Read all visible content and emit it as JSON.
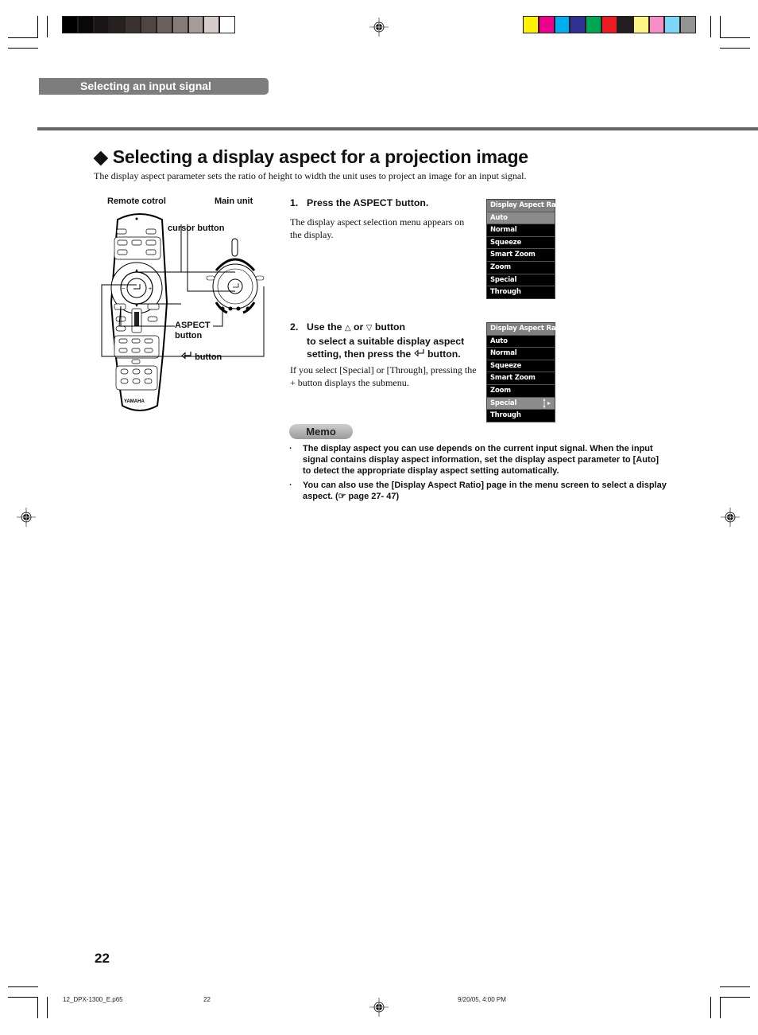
{
  "print_marks": {
    "gray_bar": [
      "#000000",
      "#0b0908",
      "#191514",
      "#26211f",
      "#3a3230",
      "#4f4644",
      "#6a605d",
      "#857b78",
      "#a69d9a",
      "#d4cbca",
      "#ffffff"
    ],
    "color_bar": [
      "#fff200",
      "#ec008c",
      "#00aeef",
      "#2e3192",
      "#00a651",
      "#ed1c24",
      "#231f20",
      "#fff685",
      "#f78fc7",
      "#7ed7f7",
      "#939393"
    ]
  },
  "header": {
    "section_tab": "Selecting an input signal"
  },
  "main": {
    "title_icon": "◆",
    "title": "Selecting a display aspect for a projection image",
    "intro": "The display aspect parameter sets the ratio of height to width the unit uses to project an image for an input signal."
  },
  "figure": {
    "remote_label": "Remote cotrol",
    "main_unit_label": "Main unit",
    "cursor_button_label": "cursor button",
    "aspect_button_label_1": "ASPECT",
    "aspect_button_label_2": "button",
    "enter_button_label": "button",
    "remote_brand": "YAMAHA"
  },
  "steps": [
    {
      "number": "1.",
      "heading": "Press the ASPECT button.",
      "body": "The display aspect selection menu appears on the display."
    },
    {
      "number": "2.",
      "heading_part1": "Use the",
      "up_symbol": "△",
      "heading_or": "or",
      "down_symbol": "▽",
      "heading_part2": "button",
      "heading_line2": "to select a suitable display aspect",
      "heading_line3": "setting, then press the",
      "heading_line3_end": "button.",
      "body": "If you select [Special] or [Through], pressing the + button displays the submenu."
    }
  ],
  "osd_menus": [
    {
      "title": "Display Aspect Ratio",
      "items": [
        "Auto",
        "Normal",
        "Squeeze",
        "Smart Zoom",
        "Zoom",
        "Special",
        "Through"
      ],
      "selected": "Auto"
    },
    {
      "title": "Display Aspect Ratio",
      "items": [
        "Auto",
        "Normal",
        "Squeeze",
        "Smart Zoom",
        "Zoom",
        "Special",
        "Through"
      ],
      "selected": "Special"
    }
  ],
  "memo": {
    "label": "Memo",
    "bullet": "·",
    "items": [
      "The display aspect you can use depends on the current input signal. When the input signal contains display aspect information, set the display aspect parameter to [Auto] to detect the appropriate display aspect setting automatically.",
      "You can also use the [Display Aspect Ratio] page in the menu screen to select a display aspect. (☞ page 27- 47)"
    ]
  },
  "footer": {
    "page_number": "22",
    "file_name": "12_DPX-1300_E.p65",
    "slug_page": "22",
    "timestamp": "9/20/05, 4:00 PM"
  }
}
